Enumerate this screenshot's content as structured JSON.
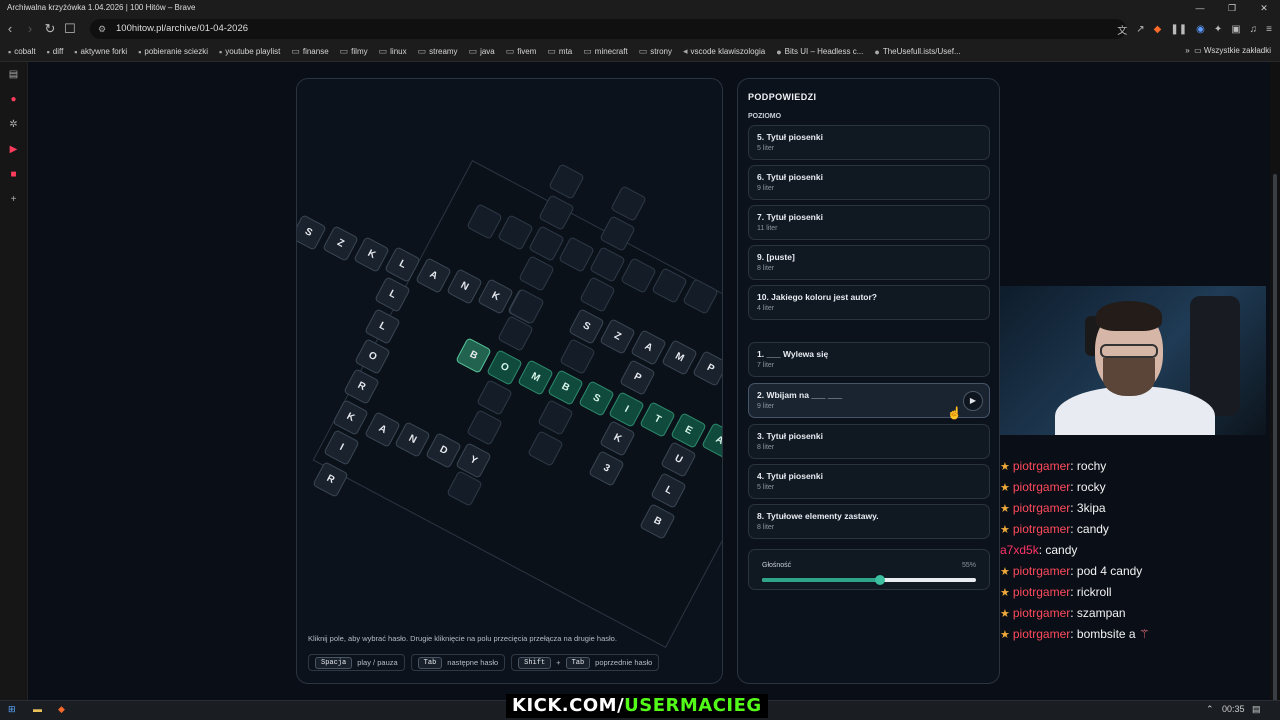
{
  "window": {
    "title": "Archiwalna krzyżówka 1.04.2026 | 100 Hitów – Brave"
  },
  "address": {
    "url": "100hitow.pl/archive/01-04-2026"
  },
  "bookmarks": [
    "cobalt",
    "diff",
    "aktywne forki",
    "pobieranie sciezki",
    "youtube playlist",
    "finanse",
    "filmy",
    "linux",
    "streamy",
    "java",
    "fivem",
    "mta",
    "minecraft",
    "strony",
    "vscode klawiszologia",
    "Bits UI – Headless c...",
    "TheUsefull.ists/Usef..."
  ],
  "bookmarks_all": "Wszystkie zakładki",
  "crossword": {
    "word_across_active": [
      "B",
      "O",
      "M",
      "B",
      "S",
      "I",
      "T",
      "E",
      "A"
    ],
    "word_down1": [
      "S",
      "Z",
      "K",
      "L",
      "A",
      "N",
      "K",
      "I"
    ],
    "word_left_vertical": [
      "L",
      "L",
      "O",
      "R",
      "K"
    ],
    "word_bottom": [
      "I",
      "A",
      "N",
      "D",
      "Y",
      "R"
    ],
    "word_right": [
      "S",
      "Z",
      "A",
      "M",
      "P",
      "A",
      "N"
    ],
    "word_lower_right": [
      "P",
      "K",
      "U",
      "L",
      "B",
      "3"
    ],
    "numbers": [
      "5",
      "3",
      "2",
      "6",
      "7",
      "1",
      "10"
    ],
    "hint_text": "Kliknij pole, aby wybrać hasło. Drugie kliknięcie na polu przecięcia przełącza na drugie hasło.",
    "keys": [
      {
        "key": "Spacja",
        "desc": "play / pauza"
      },
      {
        "key": "Tab",
        "desc": "następne hasło"
      },
      {
        "key": "Shift",
        "key2": "Tab",
        "desc": "poprzednie hasło"
      }
    ]
  },
  "clues": {
    "title": "PODPOWIEDZI",
    "section_across": "POZIOMO",
    "across": [
      {
        "label": "5. Tytuł piosenki",
        "len": "5 liter"
      },
      {
        "label": "6. Tytuł piosenki",
        "len": "9 liter"
      },
      {
        "label": "7. Tytuł piosenki",
        "len": "11 liter"
      },
      {
        "label": "9. [puste]",
        "len": "8 liter"
      },
      {
        "label": "10. Jakiego koloru jest autor?",
        "len": "4 liter"
      }
    ],
    "down": [
      {
        "label": "1. ___ Wylewa się",
        "len": "7 liter"
      },
      {
        "label": "2. Wbijam na ___ ___",
        "len": "9 liter"
      },
      {
        "label": "3. Tytuł piosenki",
        "len": "8 liter"
      },
      {
        "label": "4. Tytuł piosenki",
        "len": "5 liter"
      },
      {
        "label": "8. Tytułowe elementy zastawy.",
        "len": "8 liter"
      }
    ],
    "selected_index": 1,
    "volume_label": "Głośność",
    "volume_value": "55%",
    "volume_fraction": 0.55
  },
  "chat": [
    {
      "user": "piotrgamer",
      "text": ": rochy"
    },
    {
      "user": "piotrgamer",
      "text": ": rocky"
    },
    {
      "user": "piotrgamer",
      "text": ": 3kipa"
    },
    {
      "user": "piotrgamer",
      "text": ": candy"
    },
    {
      "user": "a7xd5k",
      "text": ": candy"
    },
    {
      "user": "piotrgamer",
      "text": ": pod 4 candy"
    },
    {
      "user": "piotrgamer",
      "text": ": rickroll"
    },
    {
      "user": "piotrgamer",
      "text": ": szampan"
    },
    {
      "user": "piotrgamer",
      "text": ": bombsite a"
    }
  ],
  "overlay": {
    "kick_white": "KICK.COM/",
    "kick_green": "USERMACIEG"
  },
  "taskbar": {
    "time": "00:35"
  }
}
